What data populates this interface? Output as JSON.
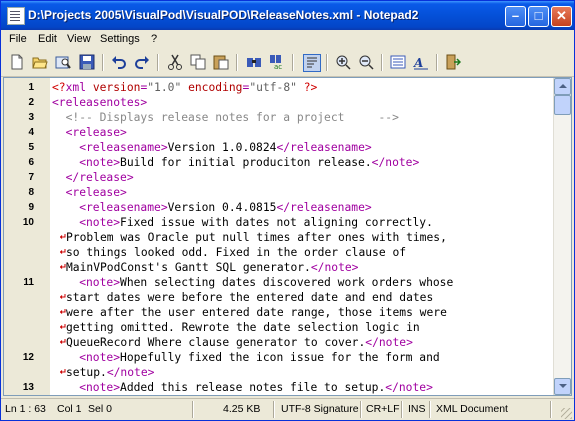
{
  "window": {
    "title": "D:\\Projects 2005\\VisualPod\\VisualPOD\\ReleaseNotes.xml - Notepad2",
    "minimize_glyph": "–",
    "maximize_glyph": "□",
    "close_glyph": "✕"
  },
  "menu": [
    "File",
    "Edit",
    "View",
    "Settings",
    "?"
  ],
  "toolbar_icons": [
    "new-file-icon",
    "open-file-icon",
    "browse-icon",
    "save-icon",
    "undo-icon",
    "redo-icon",
    "cut-icon",
    "copy-icon",
    "paste-icon",
    "find-icon",
    "replace-icon",
    "word-wrap-icon",
    "zoom-in-icon",
    "zoom-out-icon",
    "view-scheme-icon",
    "font-icon",
    "exit-icon"
  ],
  "editor": {
    "lines": [
      {
        "num": "1",
        "code": [
          [
            "pi",
            "<?"
          ],
          [
            "tag",
            "xml "
          ],
          [
            "attr",
            "version"
          ],
          [
            "tag",
            "="
          ],
          [
            "str",
            "\"1.0\""
          ],
          [
            "tag",
            " "
          ],
          [
            "attr",
            "encoding"
          ],
          [
            "tag",
            "="
          ],
          [
            "str",
            "\"utf-8\""
          ],
          [
            "tag",
            " "
          ],
          [
            "pi",
            "?>"
          ]
        ]
      },
      {
        "num": "2",
        "code": [
          [
            "tag",
            "<releasenotes>"
          ]
        ]
      },
      {
        "num": "3",
        "code": [
          [
            "com",
            "  <!-- Displays release notes for a project     -->"
          ]
        ]
      },
      {
        "num": "4",
        "code": [
          [
            "tag",
            "  <release>"
          ]
        ]
      },
      {
        "num": "5",
        "code": [
          [
            "tag",
            "    <releasename>"
          ],
          [
            "txt",
            "Version 1.0.0824"
          ],
          [
            "tag",
            "</releasename>"
          ]
        ]
      },
      {
        "num": "6",
        "code": [
          [
            "tag",
            "    <note>"
          ],
          [
            "txt",
            "Build for initial produciton release."
          ],
          [
            "tag",
            "</note>"
          ]
        ]
      },
      {
        "num": "7",
        "code": [
          [
            "tag",
            "  </release>"
          ]
        ]
      },
      {
        "num": "8",
        "code": [
          [
            "tag",
            "  <release>"
          ]
        ]
      },
      {
        "num": "9",
        "code": [
          [
            "tag",
            "    <releasename>"
          ],
          [
            "txt",
            "Version 0.4.0815"
          ],
          [
            "tag",
            "</releasename>"
          ]
        ]
      },
      {
        "num": "10",
        "code": [
          [
            "tag",
            "    <note>"
          ],
          [
            "txt",
            "Fixed issue with dates not aligning correctly."
          ]
        ]
      },
      {
        "num": "",
        "wrap": true,
        "code": [
          [
            "txt",
            "Problem was Oracle put null times after ones with times,"
          ]
        ]
      },
      {
        "num": "",
        "wrap": true,
        "code": [
          [
            "txt",
            "so things looked odd. Fixed in the order clause of"
          ]
        ]
      },
      {
        "num": "",
        "wrap": true,
        "code": [
          [
            "txt",
            "MainVPodConst's Gantt SQL generator."
          ],
          [
            "tag",
            "</note>"
          ]
        ]
      },
      {
        "num": "11",
        "code": [
          [
            "tag",
            "    <note>"
          ],
          [
            "txt",
            "When selecting dates discovered work orders whose"
          ]
        ]
      },
      {
        "num": "",
        "wrap": true,
        "code": [
          [
            "txt",
            "start dates were before the entered date and end dates"
          ]
        ]
      },
      {
        "num": "",
        "wrap": true,
        "code": [
          [
            "txt",
            "were after the user entered date range, those items were"
          ]
        ]
      },
      {
        "num": "",
        "wrap": true,
        "code": [
          [
            "txt",
            "getting omitted. Rewrote the date selection logic in"
          ]
        ]
      },
      {
        "num": "",
        "wrap": true,
        "code": [
          [
            "txt",
            "QueueRecord Where clause generator to cover."
          ],
          [
            "tag",
            "</note>"
          ]
        ]
      },
      {
        "num": "12",
        "code": [
          [
            "tag",
            "    <note>"
          ],
          [
            "txt",
            "Hopefully fixed the icon issue for the form and"
          ]
        ]
      },
      {
        "num": "",
        "wrap": true,
        "code": [
          [
            "txt",
            "setup."
          ],
          [
            "tag",
            "</note>"
          ]
        ]
      },
      {
        "num": "13",
        "code": [
          [
            "tag",
            "    <note>"
          ],
          [
            "txt",
            "Added this release notes file to setup."
          ],
          [
            "tag",
            "</note>"
          ]
        ]
      }
    ]
  },
  "status": {
    "position": "Ln 1 : 63",
    "col": "Col 1",
    "sel": "Sel 0",
    "size": "4.25 KB",
    "encoding": "UTF-8 Signature",
    "line_endings": "CR+LF",
    "mode": "INS",
    "doc_type": "XML Document"
  }
}
